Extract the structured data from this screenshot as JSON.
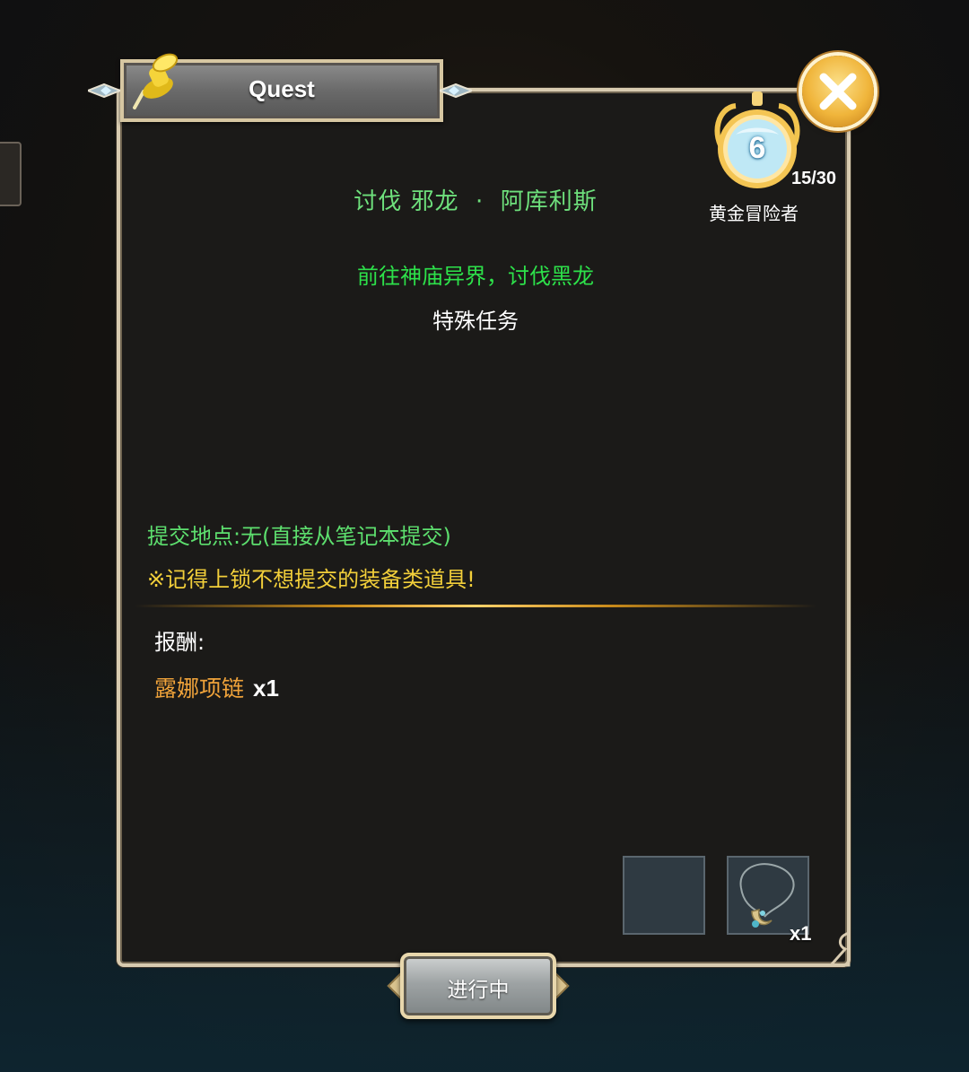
{
  "window": {
    "title": "Quest"
  },
  "rank": {
    "level": "6",
    "progress": "15/30",
    "label": "黄金冒险者"
  },
  "quest": {
    "name": "讨伐 邪龙  ·  阿库利斯",
    "objective": "前往神庙异界，讨伐黑龙",
    "type": "特殊任务",
    "submit_location": "提交地点:无(直接从笔记本提交)",
    "reminder": "※记得上锁不想提交的装备类道具!"
  },
  "rewards": {
    "label": "报酬:",
    "items": [
      {
        "name": "露娜项链",
        "qty": "x1"
      }
    ]
  },
  "slots": {
    "item_qty": "x1"
  },
  "status_button": {
    "label": "进行中"
  },
  "colors": {
    "quest_name": "#6ee07c",
    "objective": "#2de14a",
    "reminder": "#f2cf3a",
    "reward_item": "#f0a33a",
    "close_button": "#f0b53b"
  },
  "icons": [
    "pushpin-icon",
    "close-icon",
    "medal-icon",
    "necklace-icon"
  ]
}
